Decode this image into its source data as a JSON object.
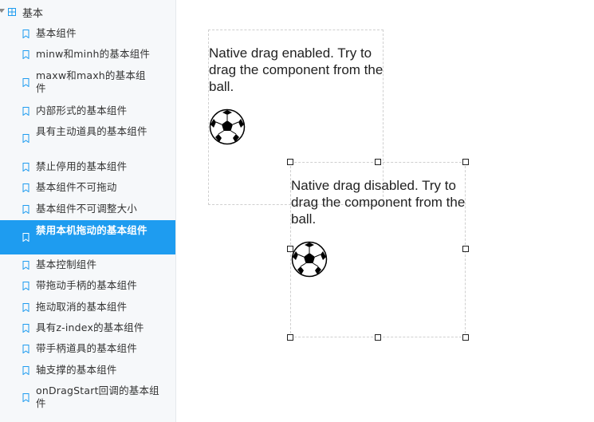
{
  "sidebar": {
    "root_label": "基本",
    "items": [
      {
        "label": "基本组件"
      },
      {
        "label": "minw和minh的基本组件"
      },
      {
        "label": "maxw和maxh的基本组件"
      },
      {
        "label": "内部形式的基本组件"
      },
      {
        "label": "具有主动道具的基本组件"
      },
      {
        "label": "禁止停用的基本组件"
      },
      {
        "label": "基本组件不可拖动"
      },
      {
        "label": "基本组件不可调整大小"
      },
      {
        "label": "禁用本机拖动的基本组件"
      },
      {
        "label": "基本控制组件"
      },
      {
        "label": "带拖动手柄的基本组件"
      },
      {
        "label": "拖动取消的基本组件"
      },
      {
        "label": "具有z-index的基本组件"
      },
      {
        "label": "带手柄道具的基本组件"
      },
      {
        "label": "轴支撑的基本组件"
      },
      {
        "label": "onDragStart回调的基本组件"
      }
    ]
  },
  "canvas": {
    "box_enabled_text": "Native drag enabled. Try to drag the component from the ball.",
    "box_disabled_text": "Native drag disabled. Try to drag the component from the ball."
  },
  "colors": {
    "active_bg": "#1e9cf0",
    "icon_blue": "#1e9cf0",
    "sidebar_bg": "#f6f8fa"
  }
}
